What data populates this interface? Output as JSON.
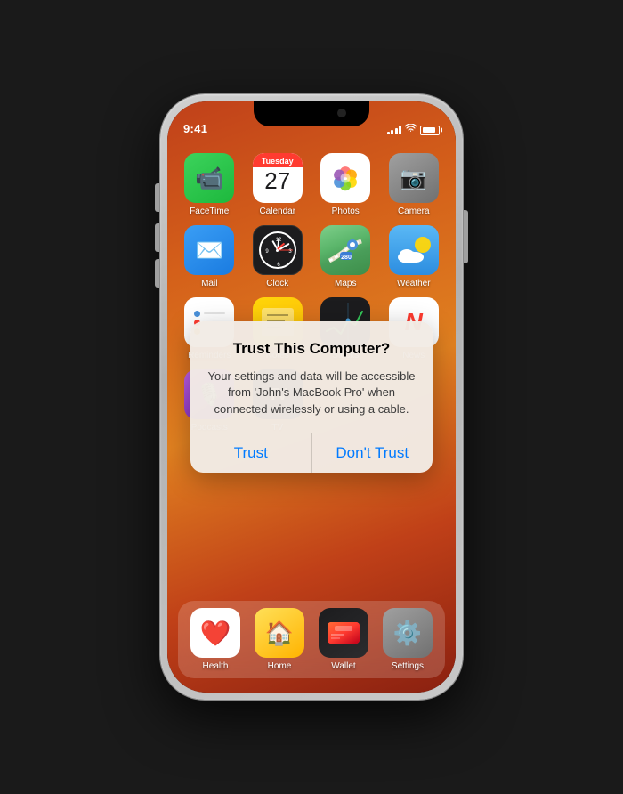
{
  "phone": {
    "status_bar": {
      "time": "9:41"
    },
    "apps": {
      "row1": [
        {
          "id": "facetime",
          "label": "FaceTime"
        },
        {
          "id": "calendar",
          "label": "Calendar",
          "calendar_day": "27",
          "calendar_month": "Tuesday"
        },
        {
          "id": "photos",
          "label": "Photos"
        },
        {
          "id": "camera",
          "label": "Camera"
        }
      ],
      "row2": [
        {
          "id": "mail",
          "label": "Mail"
        },
        {
          "id": "clock",
          "label": "Clock"
        },
        {
          "id": "maps",
          "label": "Maps"
        },
        {
          "id": "weather",
          "label": "Weather"
        }
      ],
      "row3": [
        {
          "id": "reminders",
          "label": "Reminders"
        },
        {
          "id": "notes",
          "label": "Notes"
        },
        {
          "id": "stocks",
          "label": "Stocks"
        },
        {
          "id": "news",
          "label": "News"
        }
      ],
      "row4": [
        {
          "id": "podcasts",
          "label": "Podcasts"
        },
        {
          "id": "tv",
          "label": "TV"
        },
        {
          "id": "",
          "label": ""
        },
        {
          "id": "",
          "label": ""
        }
      ],
      "dock": [
        {
          "id": "health",
          "label": "Health"
        },
        {
          "id": "home",
          "label": "Home"
        },
        {
          "id": "wallet",
          "label": "Wallet"
        },
        {
          "id": "settings",
          "label": "Settings"
        }
      ]
    },
    "alert": {
      "title": "Trust This Computer?",
      "message": "Your settings and data will be accessible from 'John's MacBook Pro' when connected wirelessly or using a cable.",
      "btn_trust": "Trust",
      "btn_dont_trust": "Don't Trust"
    }
  }
}
